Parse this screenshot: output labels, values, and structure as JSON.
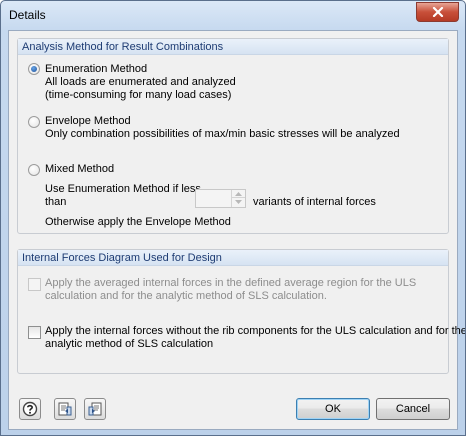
{
  "window": {
    "title": "Details",
    "close_icon": "close-icon"
  },
  "analysis": {
    "header": "Analysis Method for Result Combinations",
    "options": [
      {
        "label": "Enumeration Method",
        "desc1": "All loads are enumerated and analyzed",
        "desc2": "(time-consuming for many load cases)",
        "checked": true
      },
      {
        "label": "Envelope Method",
        "desc1": "Only combination possibilities of max/min basic stresses will be analyzed",
        "checked": false
      },
      {
        "label": "Mixed Method",
        "checked": false
      }
    ],
    "mixed": {
      "line1": "Use Enumeration Method if less",
      "line2": "than",
      "spinner_value": "",
      "variants_label": "variants of internal forces",
      "otherwise": "Otherwise apply the Envelope Method"
    }
  },
  "internal_forces": {
    "header": "Internal Forces Diagram Used for Design",
    "checkbox1": {
      "line1": "Apply the averaged internal forces in the defined average region for the ULS",
      "line2": "calculation and for the analytic method of SLS calculation.",
      "checked": false,
      "enabled": false
    },
    "checkbox2": {
      "line1": "Apply the internal forces without the rib components for the ULS calculation and for the",
      "line2": "analytic method of SLS calculation",
      "checked": false,
      "enabled": true
    }
  },
  "footer": {
    "tool_icons": [
      "help-icon",
      "load-settings-icon",
      "save-settings-icon"
    ],
    "ok_label": "OK",
    "cancel_label": "Cancel"
  }
}
